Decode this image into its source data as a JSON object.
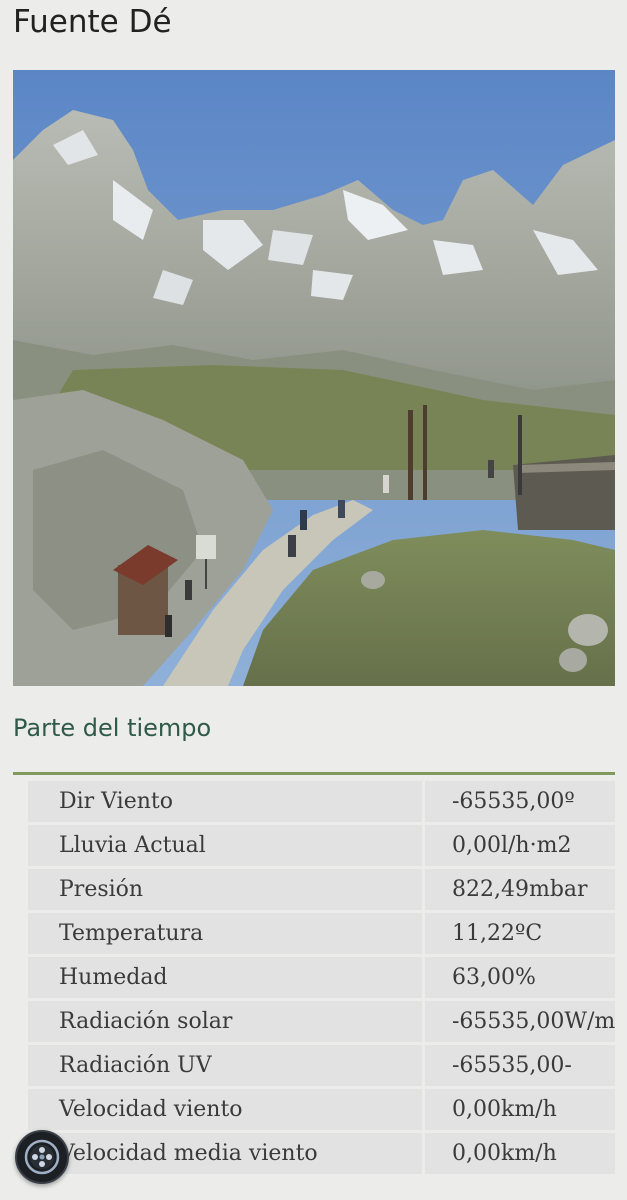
{
  "page": {
    "title": "Fuente Dé"
  },
  "webcam": {
    "icon": "webcam-image"
  },
  "weather": {
    "heading": "Parte del tiempo",
    "rows": [
      {
        "label": "Dir Viento",
        "value": "-65535,00º"
      },
      {
        "label": "Lluvia Actual",
        "value": "0,00l/h·m2"
      },
      {
        "label": "Presión",
        "value": "822,49mbar"
      },
      {
        "label": "Temperatura",
        "value": "11,22ºC"
      },
      {
        "label": "Humedad",
        "value": "63,00%"
      },
      {
        "label": "Radiación solar",
        "value": "-65535,00W/m"
      },
      {
        "label": "Radiación UV",
        "value": "-65535,00-"
      },
      {
        "label": "Velocidad viento",
        "value": "0,00km/h"
      },
      {
        "label": "Velocidad media viento",
        "value": "0,00km/h"
      }
    ]
  },
  "floating_button": {
    "icon": "assistive-touch-icon"
  },
  "colors": {
    "heading": "#2f5a48",
    "rule": "#7f9a5d",
    "row_bg": "#e2e2e2",
    "page_bg": "#ececeb"
  }
}
